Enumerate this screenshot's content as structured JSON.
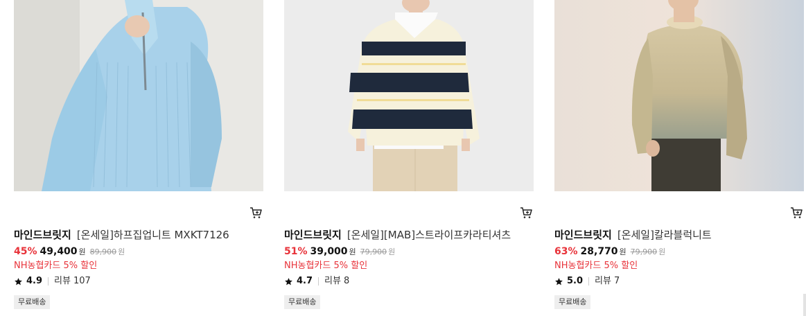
{
  "products": [
    {
      "image_alt": "light blue half-zip knit sweater",
      "brand": "마인드브릿지",
      "name": "[온세일]하프집업니트 MXKT7126",
      "discount": "45%",
      "price": "49,400",
      "currency": "원",
      "original_price": "89,900",
      "card_promo": "NH농협카드 5% 할인",
      "rating": "4.9",
      "review_label": "리뷰",
      "review_count": "107",
      "badge": "무료배송"
    },
    {
      "image_alt": "navy and cream striped rugby shirt",
      "brand": "마인드브릿지",
      "name": "[온세일][MAB]스트라이프카라티셔츠",
      "discount": "51%",
      "price": "39,000",
      "currency": "원",
      "original_price": "79,900",
      "card_promo": "NH농협카드 5% 할인",
      "rating": "4.7",
      "review_label": "리뷰",
      "review_count": "8",
      "badge": "무료배송"
    },
    {
      "image_alt": "beige gradient color-block knit",
      "brand": "마인드브릿지",
      "name": "[온세일]칼라블럭니트",
      "discount": "63%",
      "price": "28,770",
      "currency": "원",
      "original_price": "79,900",
      "card_promo": "NH농협카드 5% 할인",
      "rating": "5.0",
      "review_label": "리뷰",
      "review_count": "7",
      "badge": "무료배송"
    }
  ],
  "colors": {
    "discount": "#e8333a",
    "promo": "#e8333a",
    "badge_bg": "#eeeeee"
  },
  "icons": {
    "cart": "cart-icon",
    "star": "star-icon"
  }
}
